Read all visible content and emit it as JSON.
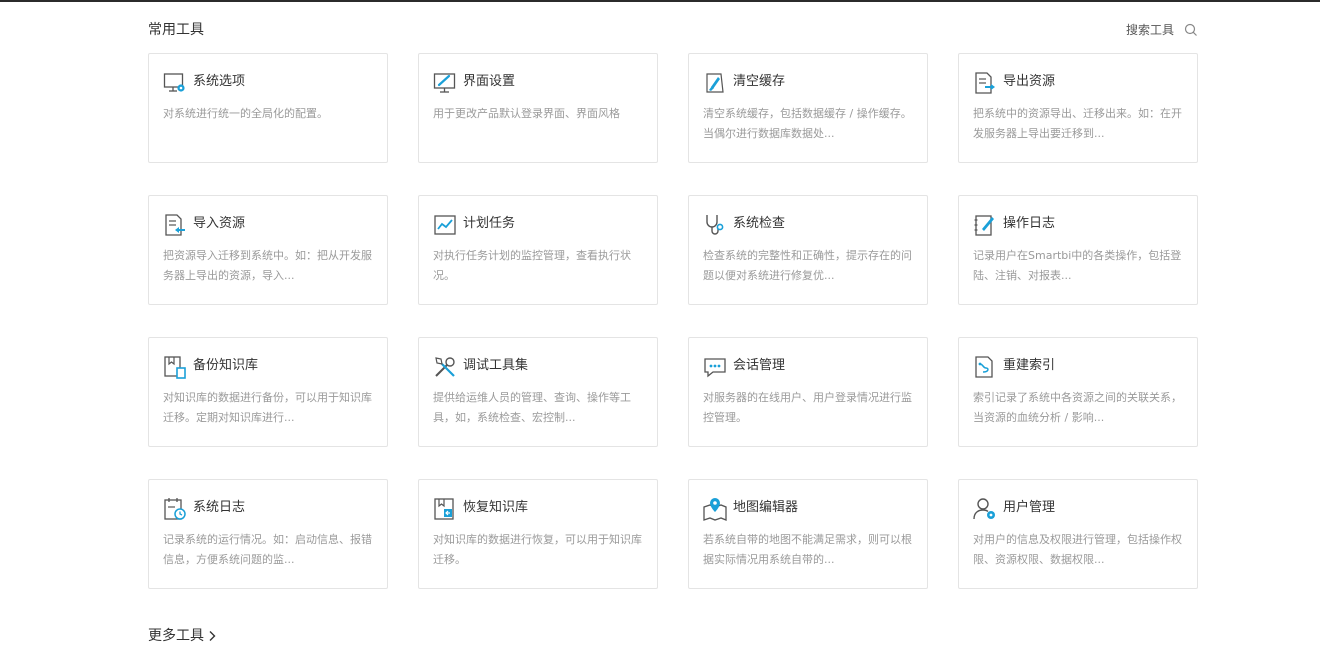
{
  "header": {
    "title": "常用工具",
    "search_label": "搜索工具"
  },
  "colors": {
    "accent": "#1aa0d8",
    "icon_gray": "#555555"
  },
  "tools": [
    {
      "title": "系统选项",
      "desc": "对系统进行统一的全局化的配置。",
      "icon": "monitor-gear-icon"
    },
    {
      "title": "界面设置",
      "desc": "用于更改产品默认登录界面、界面风格",
      "icon": "monitor-brush-icon"
    },
    {
      "title": "清空缓存",
      "desc": "清空系统缓存，包括数据缓存 / 操作缓存。当偶尔进行数据库数据处...",
      "icon": "broom-icon"
    },
    {
      "title": "导出资源",
      "desc": "把系统中的资源导出、迁移出来。如：在开发服务器上导出要迁移到...",
      "icon": "export-doc-icon"
    },
    {
      "title": "导入资源",
      "desc": "把资源导入迁移到系统中。如：把从开发服务器上导出的资源，导入...",
      "icon": "import-doc-icon"
    },
    {
      "title": "计划任务",
      "desc": "对执行任务计划的监控管理，查看执行状况。",
      "icon": "line-chart-icon"
    },
    {
      "title": "系统检查",
      "desc": "检查系统的完整性和正确性，提示存在的问题以便对系统进行修复优...",
      "icon": "stethoscope-icon"
    },
    {
      "title": "操作日志",
      "desc": "记录用户在Smartbi中的各类操作，包括登陆、注销、对报表...",
      "icon": "notebook-pen-icon"
    },
    {
      "title": "备份知识库",
      "desc": "对知识库的数据进行备份，可以用于知识库迁移。定期对知识库进行...",
      "icon": "backup-book-icon"
    },
    {
      "title": "调试工具集",
      "desc": "提供给运维人员的管理、查询、操作等工具，如，系统检查、宏控制...",
      "icon": "tools-icon"
    },
    {
      "title": "会话管理",
      "desc": "对服务器的在线用户、用户登录情况进行监控管理。",
      "icon": "chat-icon"
    },
    {
      "title": "重建索引",
      "desc": "索引记录了系统中各资源之间的关联关系，当资源的血统分析 / 影响...",
      "icon": "index-doc-icon"
    },
    {
      "title": "系统日志",
      "desc": "记录系统的运行情况。如：启动信息、报错信息，方便系统问题的监...",
      "icon": "calendar-clock-icon"
    },
    {
      "title": "恢复知识库",
      "desc": "对知识库的数据进行恢复，可以用于知识库迁移。",
      "icon": "restore-book-icon"
    },
    {
      "title": "地图编辑器",
      "desc": "若系统自带的地图不能满足需求，则可以根据实际情况用系统自带的...",
      "icon": "map-pin-icon"
    },
    {
      "title": "用户管理",
      "desc": "对用户的信息及权限进行管理，包括操作权限、资源权限、数据权限...",
      "icon": "user-gear-icon"
    }
  ],
  "footer": {
    "more_label": "更多工具"
  }
}
